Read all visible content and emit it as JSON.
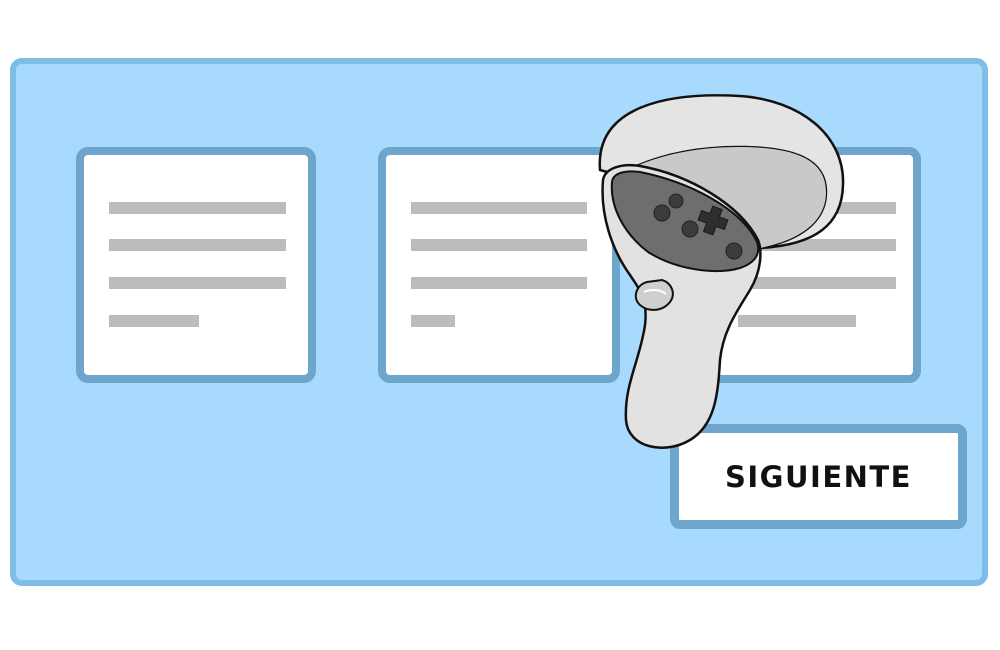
{
  "next_button": {
    "label": "SIGUIENTE"
  },
  "cards": [
    {
      "name": "content-card-1",
      "line_count": 4
    },
    {
      "name": "content-card-2",
      "line_count": 4
    },
    {
      "name": "content-card-3",
      "line_count": 4
    }
  ],
  "controller": {
    "icon": "vr-controller-icon"
  },
  "colors": {
    "panel_fill": "#a8dafd",
    "panel_border": "#7ebde6",
    "card_border": "#6ea5cc",
    "placeholder_line": "#bcbcbc",
    "controller_body": "#e4e4e4",
    "controller_face": "#6e6e6e"
  }
}
